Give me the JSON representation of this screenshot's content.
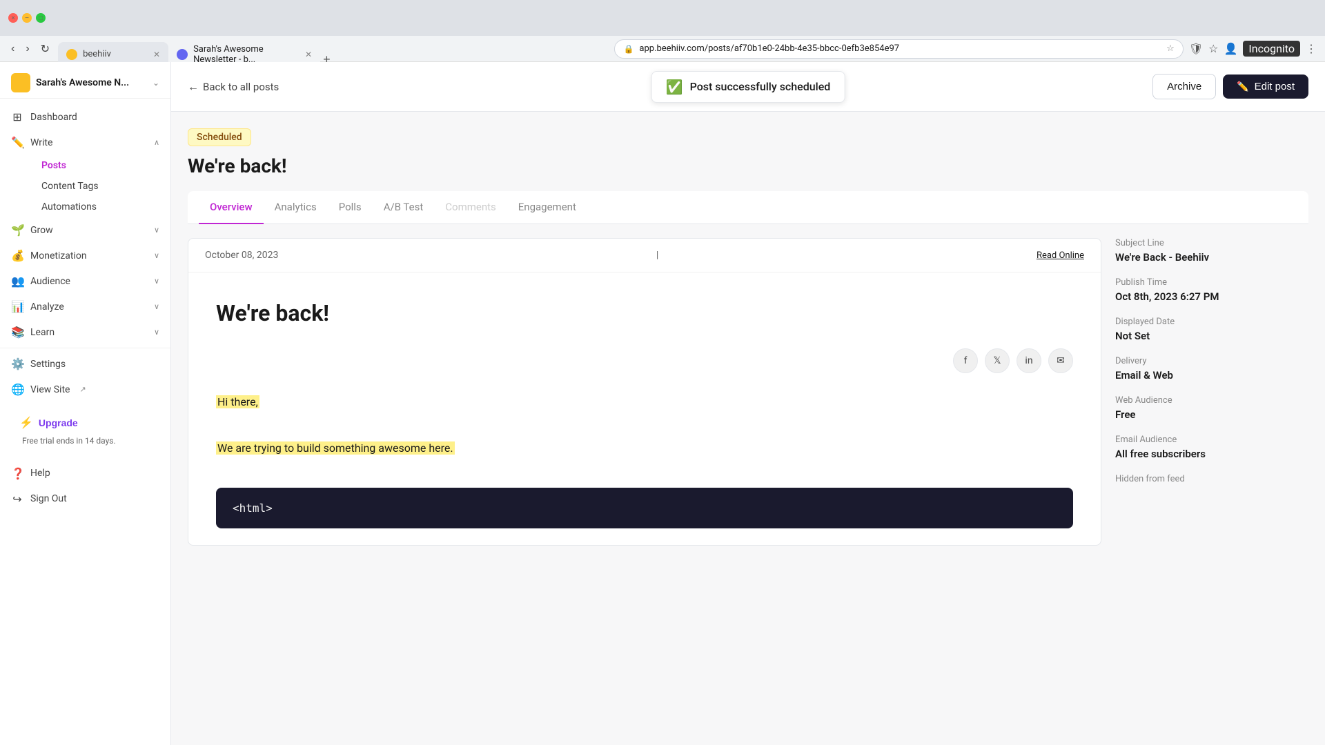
{
  "browser": {
    "tabs": [
      {
        "id": "beehiiv",
        "label": "beehiiv",
        "favicon": "beehiiv",
        "active": false
      },
      {
        "id": "sarah",
        "label": "Sarah's Awesome Newsletter - b...",
        "favicon": "sarah",
        "active": true
      }
    ],
    "address": "app.beehiiv.com/posts/af70b1e0-24bb-4e35-bbcc-0efb3e854e97",
    "incognito_label": "Incognito"
  },
  "sidebar": {
    "newsletter_name": "Sarah's Awesome N...",
    "items": [
      {
        "id": "dashboard",
        "label": "Dashboard",
        "icon": "⊞"
      },
      {
        "id": "write",
        "label": "Write",
        "icon": "✏️",
        "expandable": true,
        "expanded": true
      },
      {
        "id": "posts",
        "label": "Posts",
        "sub": true,
        "active": true
      },
      {
        "id": "content-tags",
        "label": "Content Tags",
        "sub": true
      },
      {
        "id": "automations",
        "label": "Automations",
        "sub": true
      },
      {
        "id": "grow",
        "label": "Grow",
        "icon": "🌱",
        "expandable": true
      },
      {
        "id": "monetization",
        "label": "Monetization",
        "icon": "💰",
        "expandable": true
      },
      {
        "id": "audience",
        "label": "Audience",
        "icon": "👥",
        "expandable": true
      },
      {
        "id": "analyze",
        "label": "Analyze",
        "icon": "📊",
        "expandable": true
      },
      {
        "id": "learn",
        "label": "Learn",
        "icon": "📚",
        "expandable": true
      }
    ],
    "bottom_items": [
      {
        "id": "settings",
        "label": "Settings",
        "icon": "⚙️"
      },
      {
        "id": "view-site",
        "label": "View Site",
        "icon": "🌐",
        "external": true
      },
      {
        "id": "help",
        "label": "Help",
        "icon": "❓"
      },
      {
        "id": "sign-out",
        "label": "Sign Out",
        "icon": "↪"
      }
    ],
    "upgrade_label": "Upgrade",
    "trial_notice": "Free trial ends in 14 days."
  },
  "topbar": {
    "back_label": "Back to all posts",
    "toast_message": "Post successfully scheduled",
    "archive_label": "Archive",
    "edit_label": "Edit post"
  },
  "post": {
    "status_badge": "Scheduled",
    "title": "We're back!",
    "preview_date": "October 08, 2023",
    "read_online_label": "Read Online",
    "preview_title": "We're back!",
    "hi_there": "Hi there,",
    "build_text": "We are trying to build something awesome here.",
    "code_block": "<html>"
  },
  "tabs": [
    {
      "id": "overview",
      "label": "Overview",
      "active": true
    },
    {
      "id": "analytics",
      "label": "Analytics"
    },
    {
      "id": "polls",
      "label": "Polls"
    },
    {
      "id": "ab-test",
      "label": "A/B Test"
    },
    {
      "id": "comments",
      "label": "Comments",
      "disabled": true
    },
    {
      "id": "engagement",
      "label": "Engagement"
    }
  ],
  "social_icons": [
    {
      "id": "facebook",
      "label": "f",
      "icon": "f"
    },
    {
      "id": "twitter",
      "label": "𝕏",
      "icon": "𝕏"
    },
    {
      "id": "linkedin",
      "label": "in",
      "icon": "in"
    },
    {
      "id": "email",
      "label": "✉",
      "icon": "✉"
    }
  ],
  "info_panel": {
    "subject_line_label": "Subject Line",
    "subject_line_value": "We're Back - Beehiiv",
    "publish_time_label": "Publish Time",
    "publish_time_value": "Oct 8th, 2023 6:27 PM",
    "displayed_date_label": "Displayed Date",
    "displayed_date_value": "Not Set",
    "delivery_label": "Delivery",
    "delivery_value": "Email & Web",
    "web_audience_label": "Web Audience",
    "web_audience_value": "Free",
    "email_audience_label": "Email Audience",
    "email_audience_value": "All free subscribers",
    "hidden_from_feed_label": "Hidden from feed"
  }
}
